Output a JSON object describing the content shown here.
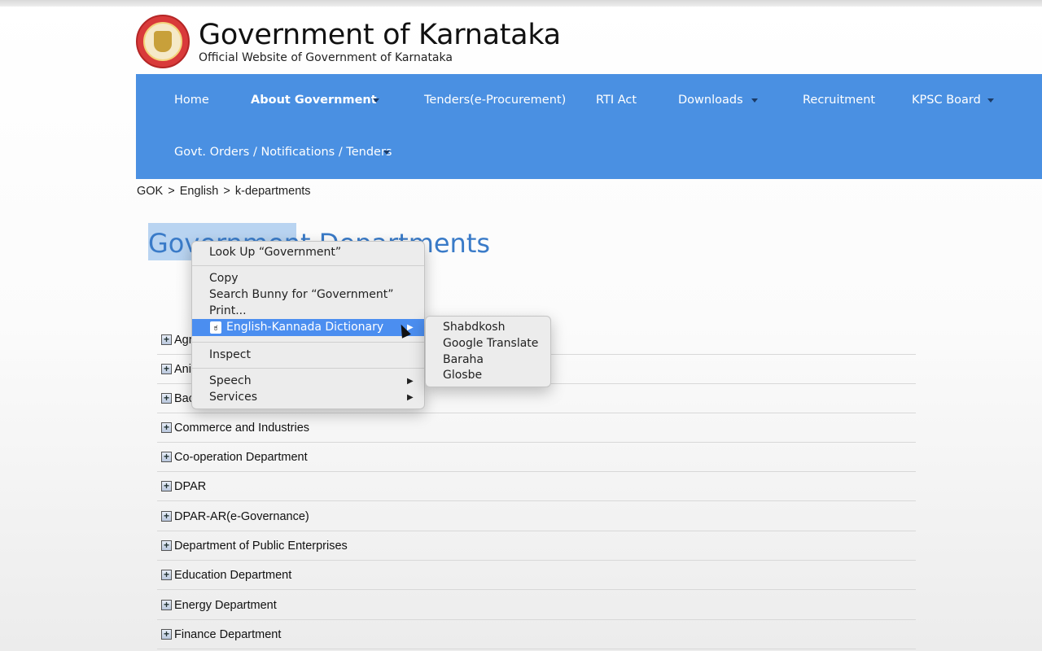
{
  "header": {
    "title": "Government of Karnataka",
    "subtitle": "Official Website of Government of Karnataka",
    "seal_icon": "karnataka-seal-icon"
  },
  "nav": {
    "items": [
      {
        "label": "Home",
        "dropdown": false
      },
      {
        "label": "About Government",
        "dropdown": true,
        "bold": true
      },
      {
        "label": "Tenders(e-Procurement)",
        "dropdown": false
      },
      {
        "label": "RTI Act",
        "dropdown": false
      },
      {
        "label": "Downloads",
        "dropdown": true
      },
      {
        "label": "Recruitment",
        "dropdown": false
      },
      {
        "label": "KPSC Board",
        "dropdown": true
      },
      {
        "label": "Govt. Orders / Notifications / Tenders",
        "dropdown": true
      }
    ]
  },
  "breadcrumb": {
    "items": [
      "GOK",
      "English",
      "k-departments"
    ],
    "separator": ">"
  },
  "page": {
    "title": "Government Departments",
    "selected_word": "Government"
  },
  "departments": [
    "Agri",
    "Ani",
    "Bac",
    "Commerce and Industries",
    "Co-operation Department",
    "DPAR",
    "DPAR-AR(e-Governance)",
    "Department of Public Enterprises",
    "Education Department",
    "Energy Department",
    "Finance Department"
  ],
  "context_menu": {
    "lookup": "Look Up “Government”",
    "copy": "Copy",
    "search": "Search Bunny for “Government”",
    "print": "Print...",
    "dictionary": "English-Kannada Dictionary",
    "dictionary_icon": "ಕ",
    "inspect": "Inspect",
    "speech": "Speech",
    "services": "Services",
    "arrow": "▶"
  },
  "submenu": {
    "items": [
      "Shabdkosh",
      "Google Translate",
      "Baraha",
      "Glosbe"
    ]
  },
  "colors": {
    "nav_bg": "#4a90e2",
    "title_blue": "#3a7bc8",
    "menu_highlight": "#4b8ef0"
  }
}
